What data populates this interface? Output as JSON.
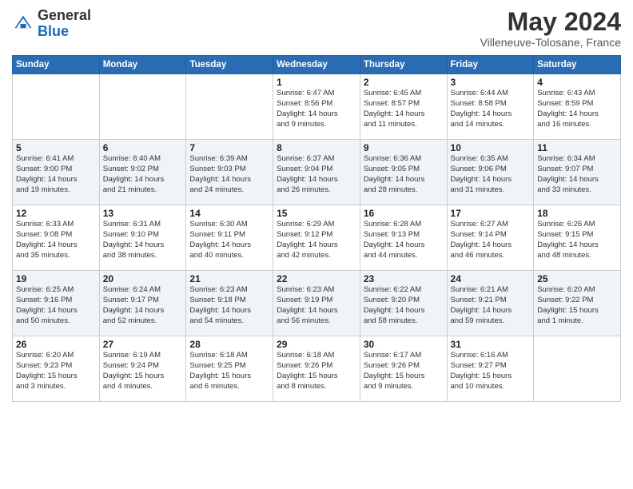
{
  "header": {
    "logo_general": "General",
    "logo_blue": "Blue",
    "month_title": "May 2024",
    "location": "Villeneuve-Tolosane, France"
  },
  "days_of_week": [
    "Sunday",
    "Monday",
    "Tuesday",
    "Wednesday",
    "Thursday",
    "Friday",
    "Saturday"
  ],
  "weeks": [
    [
      {
        "day": "",
        "info": ""
      },
      {
        "day": "",
        "info": ""
      },
      {
        "day": "",
        "info": ""
      },
      {
        "day": "1",
        "info": "Sunrise: 6:47 AM\nSunset: 8:56 PM\nDaylight: 14 hours\nand 9 minutes."
      },
      {
        "day": "2",
        "info": "Sunrise: 6:45 AM\nSunset: 8:57 PM\nDaylight: 14 hours\nand 11 minutes."
      },
      {
        "day": "3",
        "info": "Sunrise: 6:44 AM\nSunset: 8:58 PM\nDaylight: 14 hours\nand 14 minutes."
      },
      {
        "day": "4",
        "info": "Sunrise: 6:43 AM\nSunset: 8:59 PM\nDaylight: 14 hours\nand 16 minutes."
      }
    ],
    [
      {
        "day": "5",
        "info": "Sunrise: 6:41 AM\nSunset: 9:00 PM\nDaylight: 14 hours\nand 19 minutes."
      },
      {
        "day": "6",
        "info": "Sunrise: 6:40 AM\nSunset: 9:02 PM\nDaylight: 14 hours\nand 21 minutes."
      },
      {
        "day": "7",
        "info": "Sunrise: 6:39 AM\nSunset: 9:03 PM\nDaylight: 14 hours\nand 24 minutes."
      },
      {
        "day": "8",
        "info": "Sunrise: 6:37 AM\nSunset: 9:04 PM\nDaylight: 14 hours\nand 26 minutes."
      },
      {
        "day": "9",
        "info": "Sunrise: 6:36 AM\nSunset: 9:05 PM\nDaylight: 14 hours\nand 28 minutes."
      },
      {
        "day": "10",
        "info": "Sunrise: 6:35 AM\nSunset: 9:06 PM\nDaylight: 14 hours\nand 31 minutes."
      },
      {
        "day": "11",
        "info": "Sunrise: 6:34 AM\nSunset: 9:07 PM\nDaylight: 14 hours\nand 33 minutes."
      }
    ],
    [
      {
        "day": "12",
        "info": "Sunrise: 6:33 AM\nSunset: 9:08 PM\nDaylight: 14 hours\nand 35 minutes."
      },
      {
        "day": "13",
        "info": "Sunrise: 6:31 AM\nSunset: 9:10 PM\nDaylight: 14 hours\nand 38 minutes."
      },
      {
        "day": "14",
        "info": "Sunrise: 6:30 AM\nSunset: 9:11 PM\nDaylight: 14 hours\nand 40 minutes."
      },
      {
        "day": "15",
        "info": "Sunrise: 6:29 AM\nSunset: 9:12 PM\nDaylight: 14 hours\nand 42 minutes."
      },
      {
        "day": "16",
        "info": "Sunrise: 6:28 AM\nSunset: 9:13 PM\nDaylight: 14 hours\nand 44 minutes."
      },
      {
        "day": "17",
        "info": "Sunrise: 6:27 AM\nSunset: 9:14 PM\nDaylight: 14 hours\nand 46 minutes."
      },
      {
        "day": "18",
        "info": "Sunrise: 6:26 AM\nSunset: 9:15 PM\nDaylight: 14 hours\nand 48 minutes."
      }
    ],
    [
      {
        "day": "19",
        "info": "Sunrise: 6:25 AM\nSunset: 9:16 PM\nDaylight: 14 hours\nand 50 minutes."
      },
      {
        "day": "20",
        "info": "Sunrise: 6:24 AM\nSunset: 9:17 PM\nDaylight: 14 hours\nand 52 minutes."
      },
      {
        "day": "21",
        "info": "Sunrise: 6:23 AM\nSunset: 9:18 PM\nDaylight: 14 hours\nand 54 minutes."
      },
      {
        "day": "22",
        "info": "Sunrise: 6:23 AM\nSunset: 9:19 PM\nDaylight: 14 hours\nand 56 minutes."
      },
      {
        "day": "23",
        "info": "Sunrise: 6:22 AM\nSunset: 9:20 PM\nDaylight: 14 hours\nand 58 minutes."
      },
      {
        "day": "24",
        "info": "Sunrise: 6:21 AM\nSunset: 9:21 PM\nDaylight: 14 hours\nand 59 minutes."
      },
      {
        "day": "25",
        "info": "Sunrise: 6:20 AM\nSunset: 9:22 PM\nDaylight: 15 hours\nand 1 minute."
      }
    ],
    [
      {
        "day": "26",
        "info": "Sunrise: 6:20 AM\nSunset: 9:23 PM\nDaylight: 15 hours\nand 3 minutes."
      },
      {
        "day": "27",
        "info": "Sunrise: 6:19 AM\nSunset: 9:24 PM\nDaylight: 15 hours\nand 4 minutes."
      },
      {
        "day": "28",
        "info": "Sunrise: 6:18 AM\nSunset: 9:25 PM\nDaylight: 15 hours\nand 6 minutes."
      },
      {
        "day": "29",
        "info": "Sunrise: 6:18 AM\nSunset: 9:26 PM\nDaylight: 15 hours\nand 8 minutes."
      },
      {
        "day": "30",
        "info": "Sunrise: 6:17 AM\nSunset: 9:26 PM\nDaylight: 15 hours\nand 9 minutes."
      },
      {
        "day": "31",
        "info": "Sunrise: 6:16 AM\nSunset: 9:27 PM\nDaylight: 15 hours\nand 10 minutes."
      },
      {
        "day": "",
        "info": ""
      }
    ]
  ]
}
